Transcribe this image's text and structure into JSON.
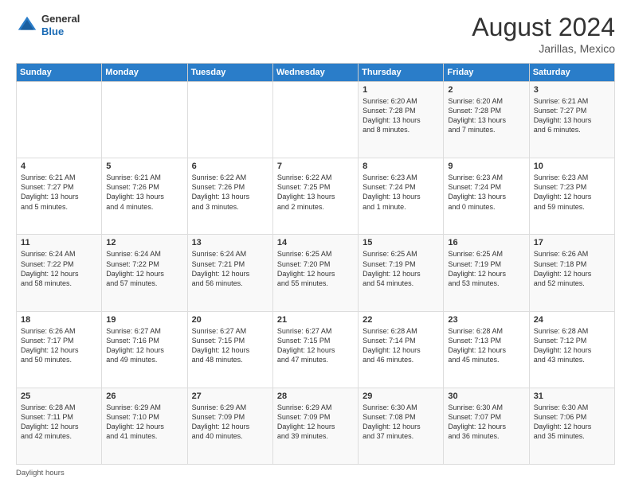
{
  "header": {
    "logo_general": "General",
    "logo_blue": "Blue",
    "month_year": "August 2024",
    "location": "Jarillas, Mexico"
  },
  "weekdays": [
    "Sunday",
    "Monday",
    "Tuesday",
    "Wednesday",
    "Thursday",
    "Friday",
    "Saturday"
  ],
  "footer": "Daylight hours",
  "weeks": [
    [
      {
        "day": "",
        "info": ""
      },
      {
        "day": "",
        "info": ""
      },
      {
        "day": "",
        "info": ""
      },
      {
        "day": "",
        "info": ""
      },
      {
        "day": "1",
        "info": "Sunrise: 6:20 AM\nSunset: 7:28 PM\nDaylight: 13 hours\nand 8 minutes."
      },
      {
        "day": "2",
        "info": "Sunrise: 6:20 AM\nSunset: 7:28 PM\nDaylight: 13 hours\nand 7 minutes."
      },
      {
        "day": "3",
        "info": "Sunrise: 6:21 AM\nSunset: 7:27 PM\nDaylight: 13 hours\nand 6 minutes."
      }
    ],
    [
      {
        "day": "4",
        "info": "Sunrise: 6:21 AM\nSunset: 7:27 PM\nDaylight: 13 hours\nand 5 minutes."
      },
      {
        "day": "5",
        "info": "Sunrise: 6:21 AM\nSunset: 7:26 PM\nDaylight: 13 hours\nand 4 minutes."
      },
      {
        "day": "6",
        "info": "Sunrise: 6:22 AM\nSunset: 7:26 PM\nDaylight: 13 hours\nand 3 minutes."
      },
      {
        "day": "7",
        "info": "Sunrise: 6:22 AM\nSunset: 7:25 PM\nDaylight: 13 hours\nand 2 minutes."
      },
      {
        "day": "8",
        "info": "Sunrise: 6:23 AM\nSunset: 7:24 PM\nDaylight: 13 hours\nand 1 minute."
      },
      {
        "day": "9",
        "info": "Sunrise: 6:23 AM\nSunset: 7:24 PM\nDaylight: 13 hours\nand 0 minutes."
      },
      {
        "day": "10",
        "info": "Sunrise: 6:23 AM\nSunset: 7:23 PM\nDaylight: 12 hours\nand 59 minutes."
      }
    ],
    [
      {
        "day": "11",
        "info": "Sunrise: 6:24 AM\nSunset: 7:22 PM\nDaylight: 12 hours\nand 58 minutes."
      },
      {
        "day": "12",
        "info": "Sunrise: 6:24 AM\nSunset: 7:22 PM\nDaylight: 12 hours\nand 57 minutes."
      },
      {
        "day": "13",
        "info": "Sunrise: 6:24 AM\nSunset: 7:21 PM\nDaylight: 12 hours\nand 56 minutes."
      },
      {
        "day": "14",
        "info": "Sunrise: 6:25 AM\nSunset: 7:20 PM\nDaylight: 12 hours\nand 55 minutes."
      },
      {
        "day": "15",
        "info": "Sunrise: 6:25 AM\nSunset: 7:19 PM\nDaylight: 12 hours\nand 54 minutes."
      },
      {
        "day": "16",
        "info": "Sunrise: 6:25 AM\nSunset: 7:19 PM\nDaylight: 12 hours\nand 53 minutes."
      },
      {
        "day": "17",
        "info": "Sunrise: 6:26 AM\nSunset: 7:18 PM\nDaylight: 12 hours\nand 52 minutes."
      }
    ],
    [
      {
        "day": "18",
        "info": "Sunrise: 6:26 AM\nSunset: 7:17 PM\nDaylight: 12 hours\nand 50 minutes."
      },
      {
        "day": "19",
        "info": "Sunrise: 6:27 AM\nSunset: 7:16 PM\nDaylight: 12 hours\nand 49 minutes."
      },
      {
        "day": "20",
        "info": "Sunrise: 6:27 AM\nSunset: 7:15 PM\nDaylight: 12 hours\nand 48 minutes."
      },
      {
        "day": "21",
        "info": "Sunrise: 6:27 AM\nSunset: 7:15 PM\nDaylight: 12 hours\nand 47 minutes."
      },
      {
        "day": "22",
        "info": "Sunrise: 6:28 AM\nSunset: 7:14 PM\nDaylight: 12 hours\nand 46 minutes."
      },
      {
        "day": "23",
        "info": "Sunrise: 6:28 AM\nSunset: 7:13 PM\nDaylight: 12 hours\nand 45 minutes."
      },
      {
        "day": "24",
        "info": "Sunrise: 6:28 AM\nSunset: 7:12 PM\nDaylight: 12 hours\nand 43 minutes."
      }
    ],
    [
      {
        "day": "25",
        "info": "Sunrise: 6:28 AM\nSunset: 7:11 PM\nDaylight: 12 hours\nand 42 minutes."
      },
      {
        "day": "26",
        "info": "Sunrise: 6:29 AM\nSunset: 7:10 PM\nDaylight: 12 hours\nand 41 minutes."
      },
      {
        "day": "27",
        "info": "Sunrise: 6:29 AM\nSunset: 7:09 PM\nDaylight: 12 hours\nand 40 minutes."
      },
      {
        "day": "28",
        "info": "Sunrise: 6:29 AM\nSunset: 7:09 PM\nDaylight: 12 hours\nand 39 minutes."
      },
      {
        "day": "29",
        "info": "Sunrise: 6:30 AM\nSunset: 7:08 PM\nDaylight: 12 hours\nand 37 minutes."
      },
      {
        "day": "30",
        "info": "Sunrise: 6:30 AM\nSunset: 7:07 PM\nDaylight: 12 hours\nand 36 minutes."
      },
      {
        "day": "31",
        "info": "Sunrise: 6:30 AM\nSunset: 7:06 PM\nDaylight: 12 hours\nand 35 minutes."
      }
    ]
  ]
}
